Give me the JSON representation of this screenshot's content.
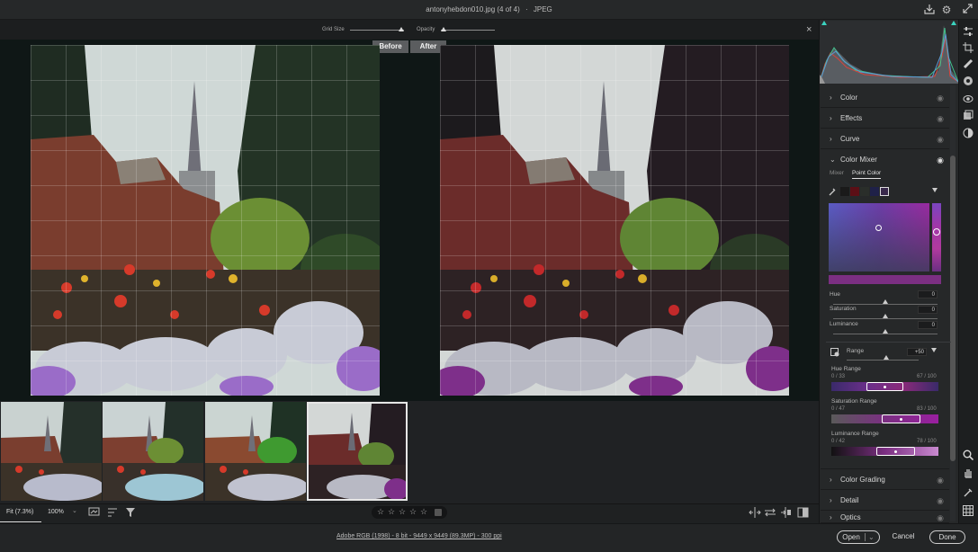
{
  "title": {
    "filename": "antonyhebdon010.jpg (4 of 4)",
    "separator": "·",
    "format": "JPEG"
  },
  "grid": {
    "grid_size_label": "Grid Size",
    "opacity_label": "Opacity",
    "grid_size_value": 0.95,
    "opacity_value": 0.05
  },
  "compare": {
    "before_label": "Before",
    "after_label": "After"
  },
  "filmstrip": {
    "count": 4,
    "selected_index": 3
  },
  "bottom": {
    "fit_label": "Fit (7.3%)",
    "zoom_label": "100%",
    "rating_stars": 0,
    "star_glyph": "☆"
  },
  "status": {
    "info": "Adobe RGB (1998) - 8 bit - 9449 x 9449 (89.3MP) - 300 ppi",
    "open": "Open",
    "cancel": "Cancel",
    "done": "Done"
  },
  "panel": {
    "sections_top": [
      {
        "label": "Color"
      },
      {
        "label": "Effects"
      },
      {
        "label": "Curve"
      }
    ],
    "color_mixer": {
      "label": "Color Mixer",
      "tabs": [
        "Mixer",
        "Point Color"
      ],
      "active_tab": 1,
      "swatches": [
        "#1a1a1a",
        "#5b0f16",
        "#2a2e2a",
        "#1f2148",
        "#3a2a4c"
      ],
      "sliders": [
        {
          "label": "Hue",
          "value": "0",
          "pos": 0.5
        },
        {
          "label": "Saturation",
          "value": "0",
          "pos": 0.5
        },
        {
          "label": "Luminance",
          "value": "0",
          "pos": 0.5
        }
      ],
      "range": {
        "label": "Range",
        "value": "+50",
        "pos": 0.55
      },
      "ranges": [
        {
          "label": "Hue Range",
          "left": "0 / 33",
          "right": "67 / 100",
          "sel_from": 0.33,
          "sel_to": 0.67
        },
        {
          "label": "Saturation Range",
          "left": "0 / 47",
          "right": "83 / 100",
          "sel_from": 0.47,
          "sel_to": 0.83
        },
        {
          "label": "Luminance Range",
          "left": "0 / 42",
          "right": "78 / 100",
          "sel_from": 0.42,
          "sel_to": 0.78
        }
      ]
    },
    "sections_bottom": [
      {
        "label": "Color Grading"
      },
      {
        "label": "Detail"
      },
      {
        "label": "Optics"
      }
    ]
  },
  "colors": {
    "accent": "#3bd4c0",
    "purple": "#7b2f82",
    "panel": "#262829"
  }
}
